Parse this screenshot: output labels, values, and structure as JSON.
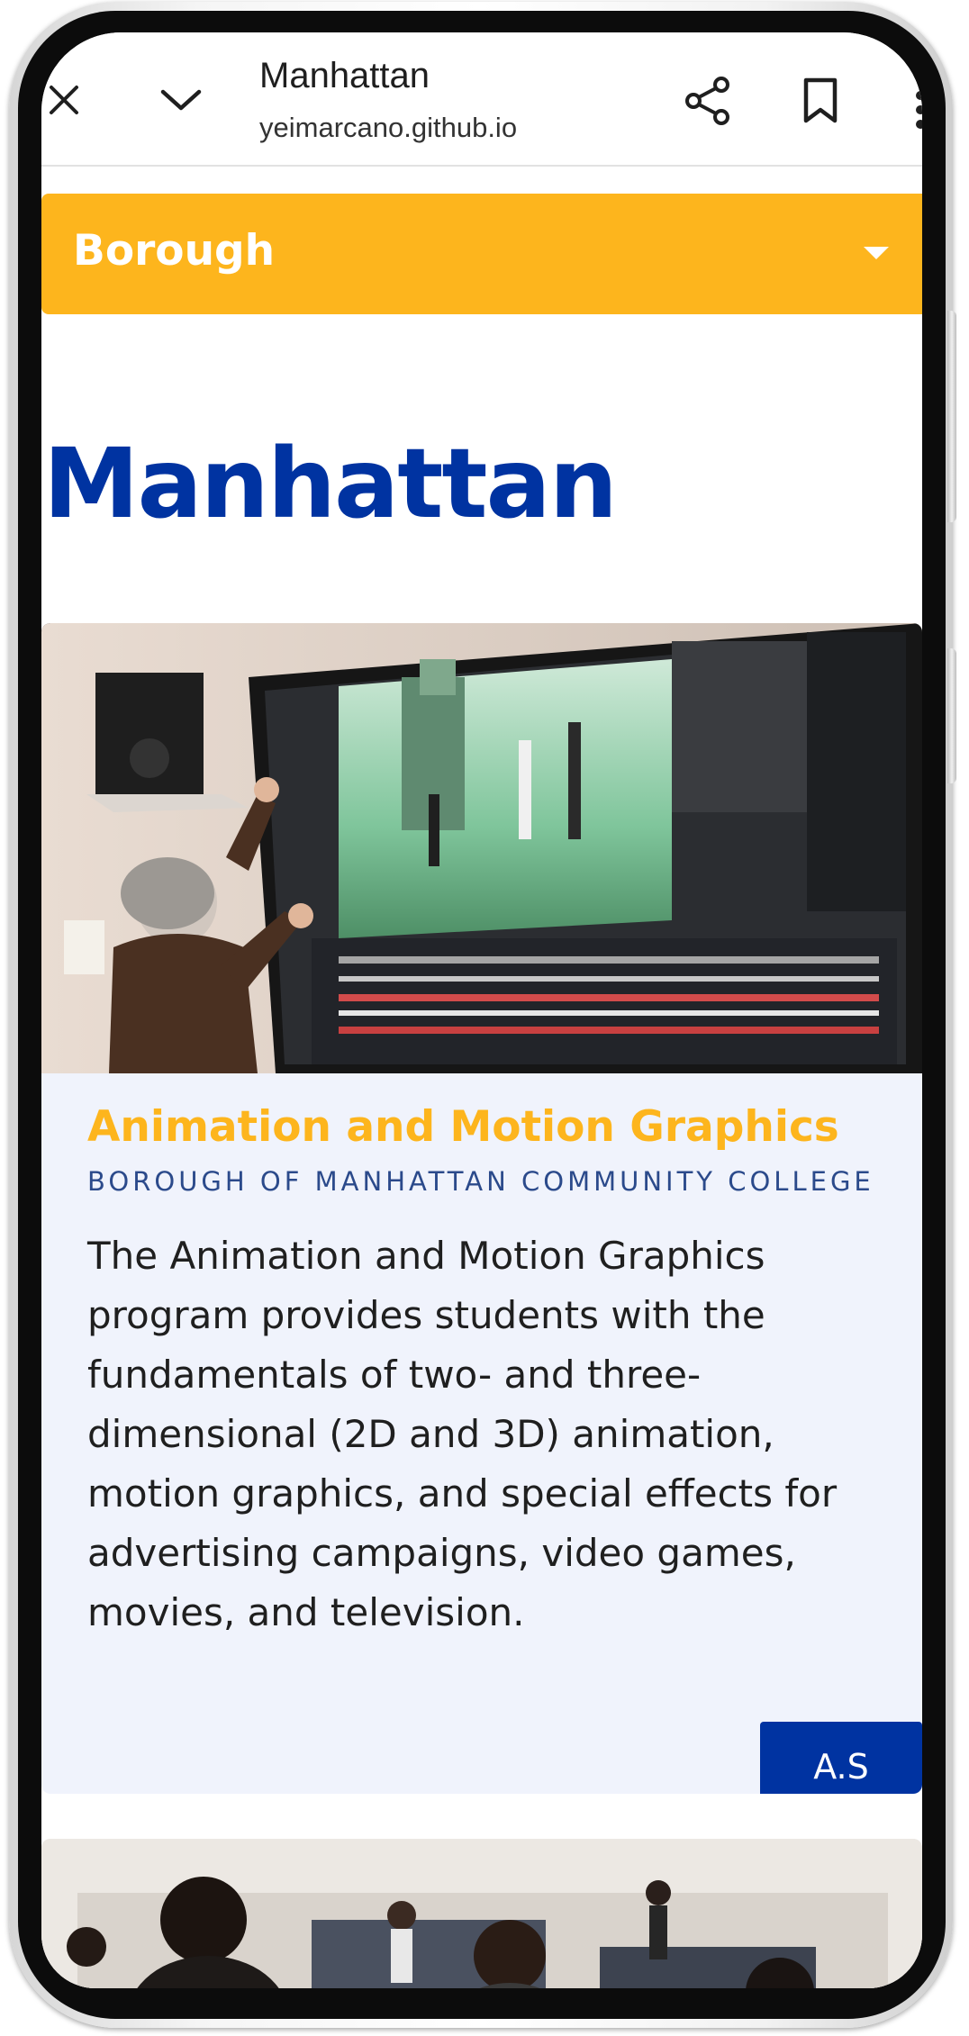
{
  "browser": {
    "title": "Manhattan",
    "url": "yeimarcano.github.io"
  },
  "borough_select": {
    "label": "Borough"
  },
  "page": {
    "heading": "Manhattan"
  },
  "program_card": {
    "title": "Animation and Motion Graphics",
    "college": "BOROUGH OF MANHATTAN COMMUNITY COLLEGE",
    "description": "The Animation and Motion Graphics program provides students with the fundamentals of two- and three-dimensional (2D and 3D) animation, motion graphics, and special effects for advertising campaigns, video games, movies, and television.",
    "degree_button": "A.S"
  },
  "colors": {
    "accent_yellow": "#fdb51d",
    "heading_blue": "#0033a1",
    "card_bg": "#f0f3fc",
    "college_text": "#2b4a8b"
  },
  "icons": [
    "close-icon",
    "chevron-down-icon",
    "share-icon",
    "bookmark-icon",
    "more-vert-icon",
    "dropdown-arrow-icon"
  ]
}
